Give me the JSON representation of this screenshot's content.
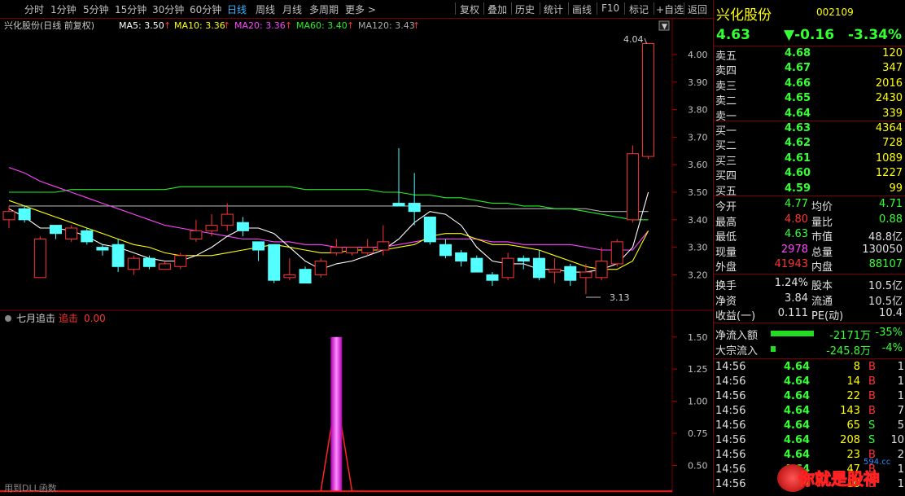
{
  "toolbar": {
    "periods": [
      "分时",
      "1分钟",
      "5分钟",
      "15分钟",
      "30分钟",
      "60分钟",
      "日线",
      "周线",
      "月线",
      "多周期",
      "更多 >"
    ],
    "active_period": "日线",
    "actions": [
      "复权",
      "叠加",
      "历史",
      "统计",
      "画线",
      "F10",
      "标记",
      "+自选",
      "返回"
    ]
  },
  "main": {
    "stock_label": "兴化股份(日线 前复权)",
    "ma5": "MA5: 3.50",
    "ma10": "MA10: 3.36",
    "ma20": "MA20: 3.36",
    "ma60": "MA60: 3.40",
    "ma120": "MA120: 3.43",
    "high_mark": "4.04",
    "low_mark": "3.13",
    "y_ticks": [
      "4.00",
      "3.90",
      "3.80",
      "3.70",
      "3.60",
      "3.50",
      "3.40",
      "3.30",
      "3.20"
    ]
  },
  "sub": {
    "label": "七月追击",
    "name": "追击",
    "value": "0.00",
    "y_ticks": [
      "1.50",
      "1.25",
      "1.00",
      "0.75",
      "0.50"
    ],
    "footer": "用到DLL函数"
  },
  "colors": {
    "up": "#ff3333",
    "down": "#54ffff",
    "ma5": "#ffffff",
    "ma10": "#ffff00",
    "ma20": "#ff44ff",
    "ma60": "#22ee22",
    "ma120": "#aaaaaa"
  },
  "chart_data": {
    "type": "candlestick",
    "candles": [
      [
        3.4,
        3.43,
        3.37,
        3.45
      ],
      [
        3.44,
        3.4,
        3.39,
        3.45
      ],
      [
        3.19,
        3.33,
        3.19,
        3.34
      ],
      [
        3.38,
        3.35,
        3.33,
        3.38
      ],
      [
        3.33,
        3.37,
        3.32,
        3.38
      ],
      [
        3.36,
        3.32,
        3.31,
        3.37
      ],
      [
        3.3,
        3.29,
        3.27,
        3.31
      ],
      [
        3.31,
        3.23,
        3.21,
        3.33
      ],
      [
        3.22,
        3.26,
        3.2,
        3.27
      ],
      [
        3.26,
        3.23,
        3.22,
        3.27
      ],
      [
        3.22,
        3.24,
        3.22,
        3.25
      ],
      [
        3.23,
        3.27,
        3.22,
        3.28
      ],
      [
        3.33,
        3.36,
        3.32,
        3.4
      ],
      [
        3.36,
        3.38,
        3.34,
        3.42
      ],
      [
        3.38,
        3.42,
        3.36,
        3.46
      ],
      [
        3.39,
        3.36,
        3.34,
        3.41
      ],
      [
        3.32,
        3.29,
        3.25,
        3.32
      ],
      [
        3.31,
        3.18,
        3.17,
        3.31
      ],
      [
        3.19,
        3.2,
        3.18,
        3.26
      ],
      [
        3.22,
        3.17,
        3.17,
        3.23
      ],
      [
        3.2,
        3.25,
        3.19,
        3.26
      ],
      [
        3.28,
        3.3,
        3.27,
        3.33
      ],
      [
        3.28,
        3.3,
        3.27,
        3.29
      ],
      [
        3.28,
        3.3,
        3.27,
        3.33
      ],
      [
        3.29,
        3.32,
        3.27,
        3.38
      ],
      [
        3.46,
        3.45,
        3.46,
        3.66
      ],
      [
        3.46,
        3.43,
        3.38,
        3.57
      ],
      [
        3.41,
        3.32,
        3.31,
        3.4
      ],
      [
        3.31,
        3.27,
        3.26,
        3.33
      ],
      [
        3.28,
        3.25,
        3.23,
        3.29
      ],
      [
        3.26,
        3.21,
        3.21,
        3.27
      ],
      [
        3.2,
        3.18,
        3.16,
        3.21
      ],
      [
        3.19,
        3.26,
        3.18,
        3.28
      ],
      [
        3.26,
        3.25,
        3.22,
        3.27
      ],
      [
        3.26,
        3.19,
        3.18,
        3.29
      ],
      [
        3.21,
        3.22,
        3.17,
        3.26
      ],
      [
        3.23,
        3.18,
        3.16,
        3.24
      ],
      [
        3.19,
        3.21,
        3.13,
        3.24
      ],
      [
        3.19,
        3.25,
        3.18,
        3.3
      ],
      [
        3.24,
        3.32,
        3.23,
        3.33
      ],
      [
        3.4,
        3.64,
        3.39,
        3.67
      ],
      [
        3.63,
        4.04,
        3.62,
        4.04
      ]
    ],
    "ma5": [
      3.44,
      3.41,
      3.37,
      3.37,
      3.36,
      3.34,
      3.31,
      3.3,
      3.28,
      3.26,
      3.25,
      3.25,
      3.27,
      3.3,
      3.34,
      3.37,
      3.37,
      3.35,
      3.3,
      3.25,
      3.22,
      3.24,
      3.25,
      3.27,
      3.29,
      3.33,
      3.39,
      3.43,
      3.42,
      3.38,
      3.3,
      3.25,
      3.24,
      3.24,
      3.22,
      3.22,
      3.21,
      3.21,
      3.22,
      3.24,
      3.3,
      3.5
    ],
    "ma10": [
      3.47,
      3.45,
      3.43,
      3.41,
      3.39,
      3.37,
      3.35,
      3.33,
      3.31,
      3.3,
      3.28,
      3.27,
      3.27,
      3.27,
      3.28,
      3.29,
      3.3,
      3.31,
      3.3,
      3.29,
      3.28,
      3.28,
      3.29,
      3.29,
      3.29,
      3.3,
      3.31,
      3.34,
      3.35,
      3.35,
      3.33,
      3.31,
      3.31,
      3.3,
      3.29,
      3.27,
      3.25,
      3.23,
      3.22,
      3.22,
      3.25,
      3.36
    ],
    "ma20": [
      3.59,
      3.57,
      3.54,
      3.52,
      3.5,
      3.48,
      3.46,
      3.44,
      3.42,
      3.4,
      3.38,
      3.37,
      3.36,
      3.35,
      3.34,
      3.33,
      3.33,
      3.32,
      3.32,
      3.31,
      3.31,
      3.3,
      3.3,
      3.3,
      3.3,
      3.31,
      3.32,
      3.33,
      3.33,
      3.33,
      3.33,
      3.32,
      3.32,
      3.31,
      3.31,
      3.31,
      3.31,
      3.3,
      3.29,
      3.29,
      3.29,
      3.36
    ],
    "ma60": [
      3.5,
      3.5,
      3.5,
      3.5,
      3.51,
      3.51,
      3.51,
      3.51,
      3.51,
      3.51,
      3.51,
      3.52,
      3.52,
      3.52,
      3.52,
      3.52,
      3.52,
      3.52,
      3.52,
      3.51,
      3.51,
      3.51,
      3.51,
      3.51,
      3.5,
      3.5,
      3.49,
      3.49,
      3.48,
      3.48,
      3.47,
      3.46,
      3.46,
      3.45,
      3.45,
      3.44,
      3.44,
      3.43,
      3.42,
      3.41,
      3.4,
      3.4
    ],
    "ma120": [
      3.45,
      3.45,
      3.45,
      3.45,
      3.45,
      3.45,
      3.45,
      3.45,
      3.45,
      3.45,
      3.45,
      3.45,
      3.45,
      3.45,
      3.45,
      3.45,
      3.45,
      3.45,
      3.45,
      3.45,
      3.45,
      3.45,
      3.45,
      3.45,
      3.45,
      3.45,
      3.45,
      3.45,
      3.45,
      3.45,
      3.45,
      3.44,
      3.44,
      3.44,
      3.44,
      3.44,
      3.44,
      3.44,
      3.43,
      3.43,
      3.43,
      3.43
    ],
    "ylim": [
      3.08,
      4.08
    ],
    "sub_ylim": [
      0.3,
      1.6
    ],
    "sub_spike_index": 21,
    "sub_spike_value": 1.5
  },
  "quote": {
    "name": "兴化股份",
    "code": "002109",
    "price": "4.63",
    "change": "▼-0.16",
    "pct": "-3.34%",
    "asks": [
      {
        "label": "卖五",
        "price": "4.68",
        "vol": "120"
      },
      {
        "label": "卖四",
        "price": "4.67",
        "vol": "347"
      },
      {
        "label": "卖三",
        "price": "4.66",
        "vol": "2016"
      },
      {
        "label": "卖二",
        "price": "4.65",
        "vol": "2430"
      },
      {
        "label": "卖一",
        "price": "4.64",
        "vol": "339"
      }
    ],
    "bids": [
      {
        "label": "买一",
        "price": "4.63",
        "vol": "4364"
      },
      {
        "label": "买二",
        "price": "4.62",
        "vol": "728"
      },
      {
        "label": "买三",
        "price": "4.61",
        "vol": "1089"
      },
      {
        "label": "买四",
        "price": "4.60",
        "vol": "1227"
      },
      {
        "label": "买五",
        "price": "4.59",
        "vol": "99"
      }
    ],
    "stats": [
      {
        "l1": "今开",
        "v1": "4.77",
        "c1": "#33ff33",
        "l2": "均价",
        "v2": "4.71",
        "c2": "#33ff33"
      },
      {
        "l1": "最高",
        "v1": "4.80",
        "c1": "#ff3333",
        "l2": "量比",
        "v2": "0.88",
        "c2": "#33ff33"
      },
      {
        "l1": "最低",
        "v1": "4.63",
        "c1": "#33ff33",
        "l2": "市值",
        "v2": "48.8亿",
        "c2": "#e0e0e0"
      },
      {
        "l1": "现量",
        "v1": "2978",
        "c1": "#ff44ff",
        "l2": "总量",
        "v2": "130050",
        "c2": "#e0e0e0"
      },
      {
        "l1": "外盘",
        "v1": "41943",
        "c1": "#ff3333",
        "l2": "内盘",
        "v2": "88107",
        "c2": "#33ff33"
      }
    ],
    "fund": [
      {
        "l1": "换手",
        "v1": "1.24%",
        "l2": "股本",
        "v2": "10.5亿"
      },
      {
        "l1": "净资",
        "v1": "3.84",
        "l2": "流通",
        "v2": "10.5亿"
      },
      {
        "l1": "收益(一)",
        "v1": "0.111",
        "l2": "PE(动)",
        "v2": "10.4"
      }
    ],
    "flows": [
      {
        "label": "净流入额",
        "amount": "-2171万",
        "pct": "-35%",
        "bar": 0.35
      },
      {
        "label": "大宗流入",
        "amount": "-245.8万",
        "pct": "-4%",
        "bar": 0.04
      }
    ],
    "ticks": [
      {
        "time": "14:56",
        "price": "4.64",
        "vol": "8",
        "side": "B",
        "n": "1"
      },
      {
        "time": "14:56",
        "price": "4.64",
        "vol": "14",
        "side": "B",
        "n": "1"
      },
      {
        "time": "14:56",
        "price": "4.64",
        "vol": "22",
        "side": "B",
        "n": "1"
      },
      {
        "time": "14:56",
        "price": "4.64",
        "vol": "143",
        "side": "B",
        "n": "7"
      },
      {
        "time": "14:56",
        "price": "4.64",
        "vol": "65",
        "side": "S",
        "n": "5"
      },
      {
        "time": "14:56",
        "price": "4.64",
        "vol": "208",
        "side": "S",
        "n": "10"
      },
      {
        "time": "14:56",
        "price": "4.64",
        "vol": "23",
        "side": "B",
        "n": "2"
      },
      {
        "time": "14:56",
        "price": "4.64",
        "vol": "47",
        "side": "B",
        "n": "1"
      },
      {
        "time": "14:56",
        "price": "4.64",
        "vol": "10",
        "side": "B",
        "n": "1"
      }
    ],
    "watermark": "你就是股神",
    "watermark_site": "594.cc"
  }
}
